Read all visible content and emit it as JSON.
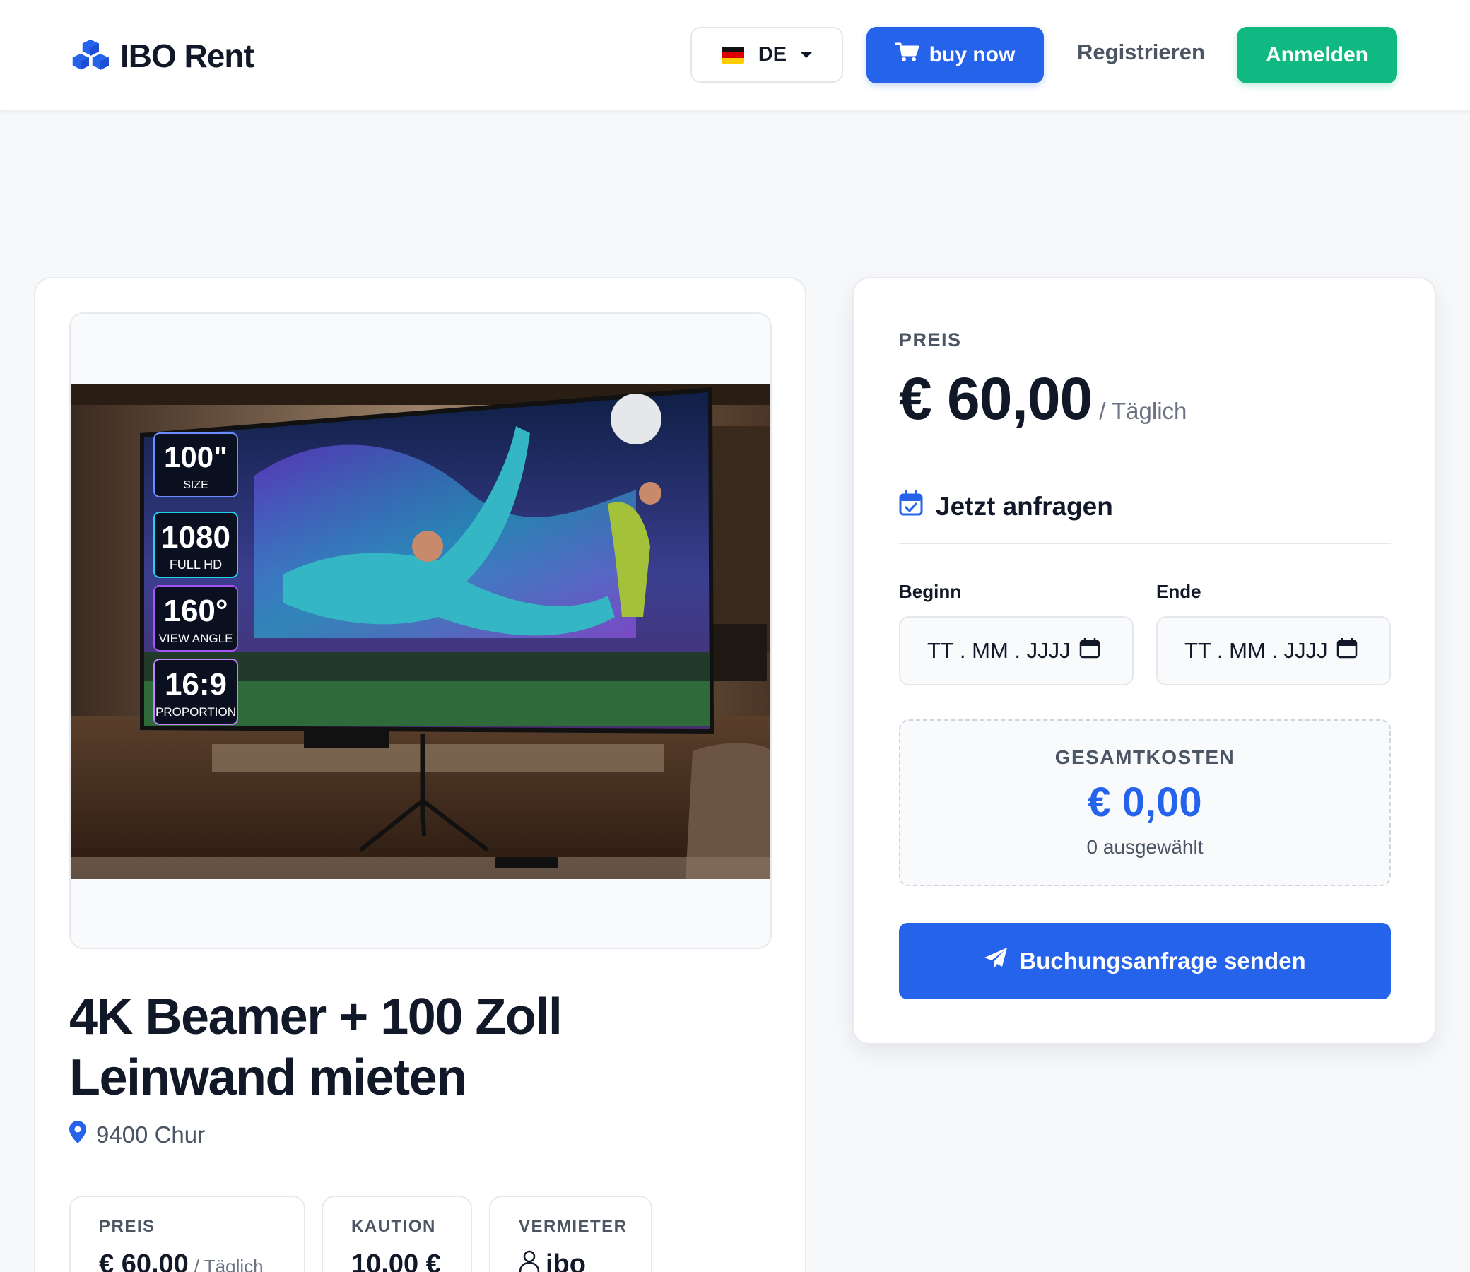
{
  "header": {
    "brand": "IBO Rent",
    "language": {
      "code": "DE"
    },
    "buy_now": "buy now",
    "register": "Registrieren",
    "login": "Anmelden"
  },
  "product": {
    "title": "4K Beamer + 100 Zoll Leinwand mieten",
    "location": "9400 Chur",
    "image_badges": [
      {
        "value": "100\"",
        "label": "SIZE"
      },
      {
        "value": "1080",
        "label": "FULL HD"
      },
      {
        "value": "160°",
        "label": "VIEW ANGLE"
      },
      {
        "value": "16:9",
        "label": "PROPORTION"
      }
    ],
    "info": {
      "price_label": "PREIS",
      "price_value": "€ 60,00",
      "price_unit": "/ Täglich",
      "deposit_label": "KAUTION",
      "deposit_value": "10,00 €",
      "owner_label": "VERMIETER",
      "owner_value": "ibo"
    }
  },
  "booking": {
    "price_label": "PREIS",
    "price_value": "€ 60,00",
    "price_unit": "/ Täglich",
    "request_title": "Jetzt anfragen",
    "start_label": "Beginn",
    "end_label": "Ende",
    "date_placeholder": "TT . MM . JJJJ",
    "total_label": "GESAMTKOSTEN",
    "total_value": "€ 0,00",
    "total_sub": "0 ausgewählt",
    "send_button": "Buchungsanfrage senden"
  },
  "colors": {
    "primary": "#2563eb",
    "success": "#10b981",
    "text": "#111827",
    "muted": "#4b5563",
    "background": "#f7f8fa"
  }
}
